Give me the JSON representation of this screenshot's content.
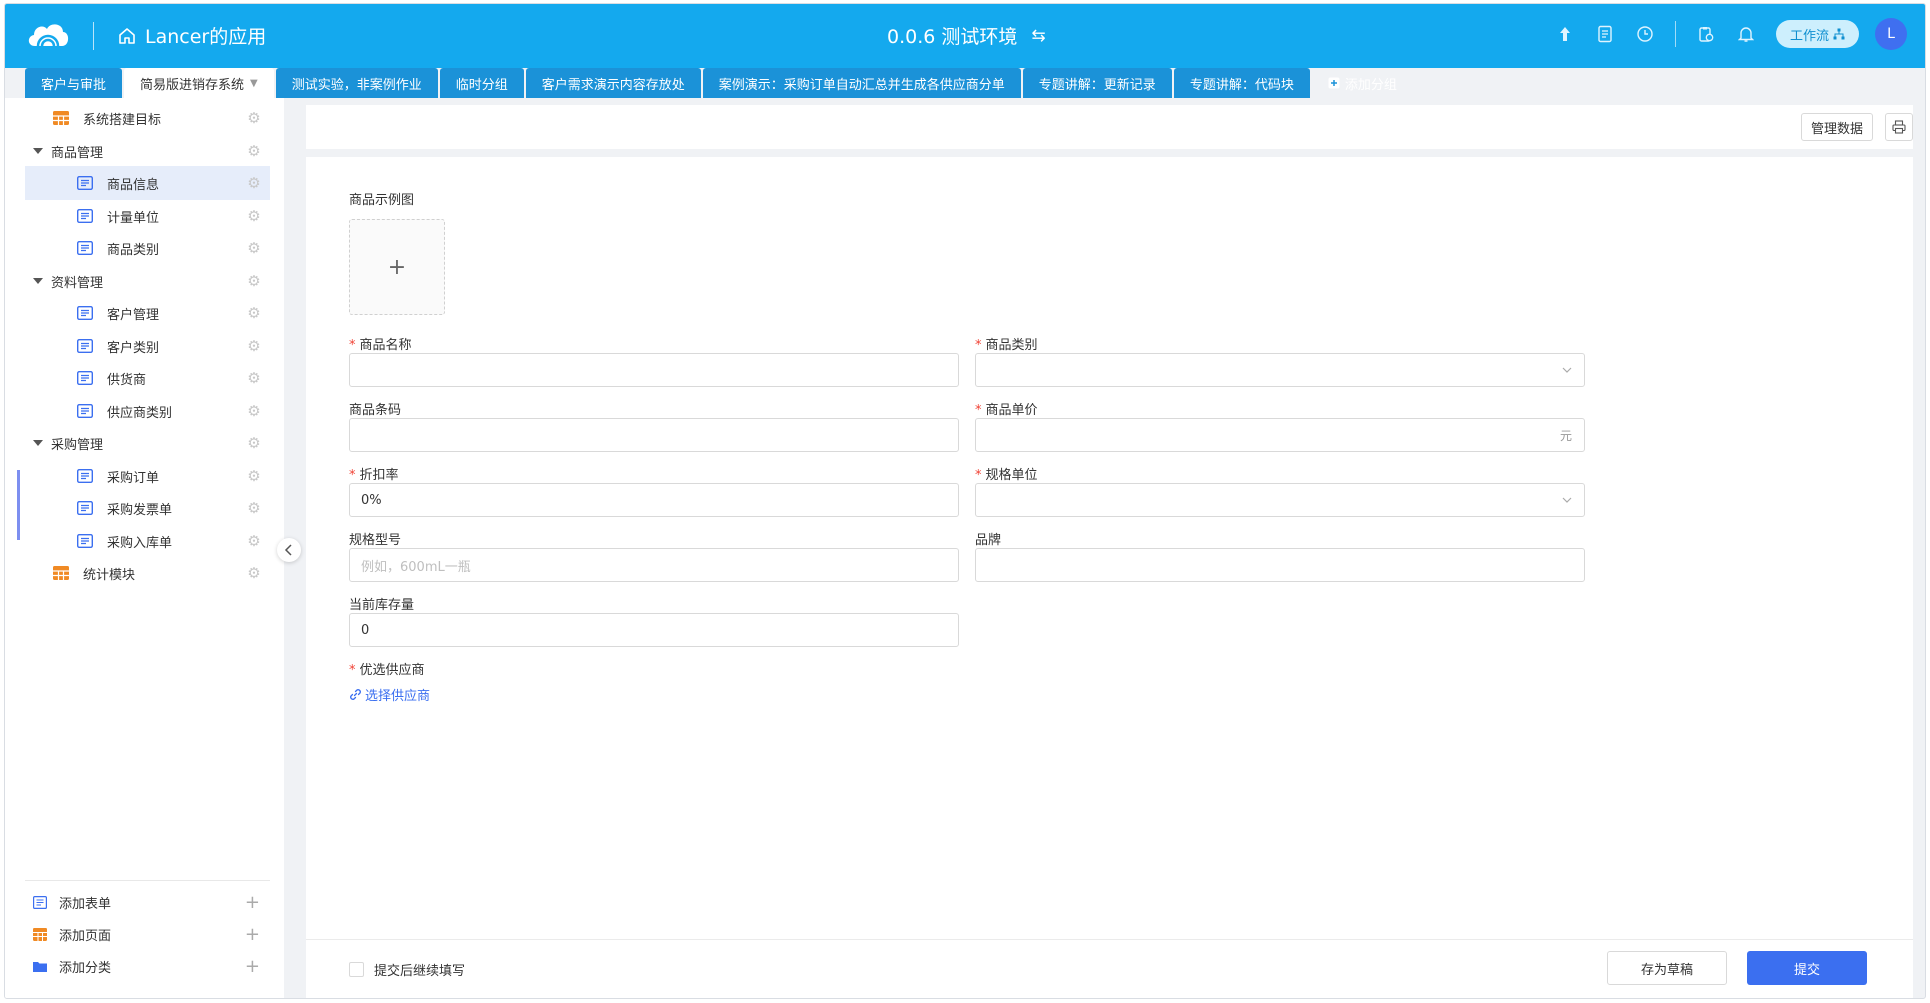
{
  "header": {
    "app_title": "Lancer的应用",
    "env_title": "0.0.6 测试环境",
    "swap_glyph": "⇆",
    "workflow_label": "工作流",
    "avatar_letter": "L"
  },
  "tabs": [
    {
      "label": "客户与审批"
    },
    {
      "label": "简易版进销存系统"
    },
    {
      "label": "测试实验，非案例作业"
    },
    {
      "label": "临时分组"
    },
    {
      "label": "客户需求演示内容存放处"
    },
    {
      "label": "案例演示：采购订单自动汇总并生成各供应商分单"
    },
    {
      "label": "专题讲解：更新记录"
    },
    {
      "label": "专题讲解：代码块"
    },
    {
      "label": "添加分组"
    }
  ],
  "sidebar": {
    "items": [
      {
        "label": "系统搭建目标"
      },
      {
        "label": "商品管理"
      },
      {
        "label": "商品信息"
      },
      {
        "label": "计量单位"
      },
      {
        "label": "商品类别"
      },
      {
        "label": "资料管理"
      },
      {
        "label": "客户管理"
      },
      {
        "label": "客户类别"
      },
      {
        "label": "供货商"
      },
      {
        "label": "供应商类别"
      },
      {
        "label": "采购管理"
      },
      {
        "label": "采购订单"
      },
      {
        "label": "采购发票单"
      },
      {
        "label": "采购入库单"
      },
      {
        "label": "统计模块"
      }
    ],
    "add_form": "添加表单",
    "add_page": "添加页面",
    "add_category": "添加分类"
  },
  "toolbar": {
    "manage_data": "管理数据"
  },
  "form": {
    "image_label": "商品示例图",
    "upload_plus": "+",
    "name_label": "商品名称",
    "name_value": "",
    "category_label": "商品类别",
    "category_value": "",
    "barcode_label": "商品条码",
    "barcode_value": "",
    "price_label": "商品单价",
    "price_value": "",
    "price_suffix": "元",
    "discount_label": "折扣率",
    "discount_value": "0%",
    "unit_label": "规格单位",
    "unit_value": "",
    "model_label": "规格型号",
    "model_placeholder": "例如，600mL一瓶",
    "brand_label": "品牌",
    "brand_value": "",
    "stock_label": "当前库存量",
    "stock_value": "0",
    "supplier_label": "优选供应商",
    "supplier_link": "选择供应商",
    "required_mark": "*"
  },
  "footer": {
    "continue_label": "提交后继续填写",
    "continue_checked": false,
    "draft_label": "存为草稿",
    "submit_label": "提交"
  },
  "colors": {
    "header_bg": "#14a9ee",
    "primary": "#3b6ff0",
    "required": "#f04134",
    "active_item_bg": "#e6edfa"
  }
}
